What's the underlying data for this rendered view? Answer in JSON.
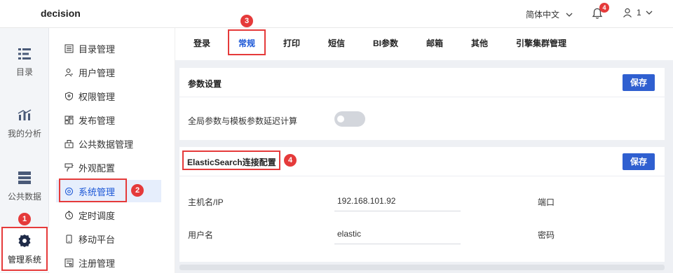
{
  "app": {
    "title": "decision"
  },
  "header": {
    "language": "简体中文",
    "notification_badge": "4",
    "user": "1"
  },
  "rail": [
    {
      "label": "目录",
      "icon": "list-icon"
    },
    {
      "label": "我的分析",
      "icon": "chart-icon"
    },
    {
      "label": "公共数据",
      "icon": "database-icon"
    },
    {
      "label": "管理系统",
      "icon": "gear-icon",
      "active": true
    }
  ],
  "menu": [
    {
      "label": "目录管理",
      "icon": "catalog-icon"
    },
    {
      "label": "用户管理",
      "icon": "user-icon"
    },
    {
      "label": "权限管理",
      "icon": "shield-icon"
    },
    {
      "label": "发布管理",
      "icon": "publish-icon"
    },
    {
      "label": "公共数据管理",
      "icon": "public-data-icon"
    },
    {
      "label": "外观配置",
      "icon": "brush-icon"
    },
    {
      "label": "系统管理",
      "icon": "gear-icon",
      "active": true
    },
    {
      "label": "定时调度",
      "icon": "timer-icon"
    },
    {
      "label": "移动平台",
      "icon": "mobile-icon"
    },
    {
      "label": "注册管理",
      "icon": "register-icon"
    }
  ],
  "tabs": [
    "登录",
    "常规",
    "打印",
    "短信",
    "BI参数",
    "邮箱",
    "其他",
    "引擎集群管理"
  ],
  "active_tab": "常规",
  "param_settings": {
    "title": "参数设置",
    "save_label": "保存",
    "toggle_label": "全局参数与模板参数延迟计算",
    "toggle_on": false
  },
  "es_settings": {
    "title": "ElasticSearch连接配置",
    "save_label": "保存",
    "host_label": "主机名/IP",
    "host_value": "192.168.101.92",
    "port_label": "端口",
    "username_label": "用户名",
    "username_value": "elastic",
    "password_label": "密码"
  },
  "markers": [
    "1",
    "2",
    "3",
    "4"
  ],
  "colors": {
    "accent": "#2f5fd0",
    "marker": "#e53a3a",
    "active_bg": "#e6eefc"
  }
}
